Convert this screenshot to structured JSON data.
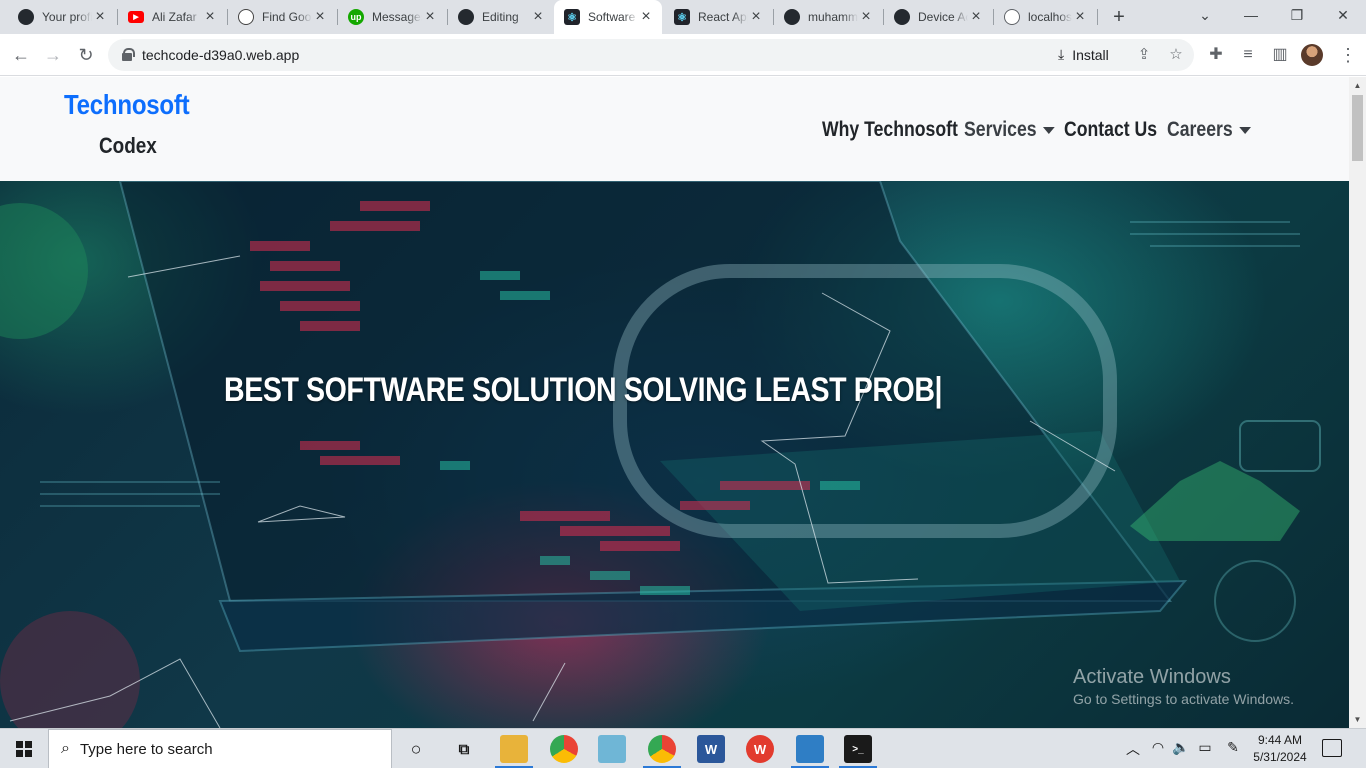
{
  "browser": {
    "tabs": [
      {
        "title": "Your profile",
        "icon": "github-icon"
      },
      {
        "title": "Ali Zafar",
        "icon": "youtube-icon"
      },
      {
        "title": "Find Good",
        "icon": "chatgpt-icon"
      },
      {
        "title": "Messages",
        "icon": "upwork-icon"
      },
      {
        "title": "Editing",
        "icon": "github-icon"
      },
      {
        "title": "Software",
        "icon": "react-icon",
        "active": true
      },
      {
        "title": "React App",
        "icon": "react-icon"
      },
      {
        "title": "muhammad",
        "icon": "github-icon"
      },
      {
        "title": "Device Activity",
        "icon": "github-icon"
      },
      {
        "title": "localhost",
        "icon": "globe-icon"
      }
    ],
    "url": "techcode-d39a0.web.app",
    "install_label": "Install"
  },
  "site": {
    "brand_primary": "Technosoft",
    "brand_secondary": "Codex",
    "nav": {
      "why": "Why Technosoft",
      "services": "Services",
      "contact": "Contact Us",
      "careers": "Careers"
    },
    "hero_headline": "BEST SOFTWARE SOLUTION SOLVING LEAST PROB|",
    "watermark_title": "Activate Windows",
    "watermark_subtitle": "Go to Settings to activate Windows."
  },
  "taskbar": {
    "search_placeholder": "Type here to search",
    "time": "9:44 AM",
    "date": "5/31/2024"
  },
  "colors": {
    "brand_blue": "#0d6efd",
    "tab_strip": "#dee1e6",
    "taskbar": "#dfe3e8"
  }
}
